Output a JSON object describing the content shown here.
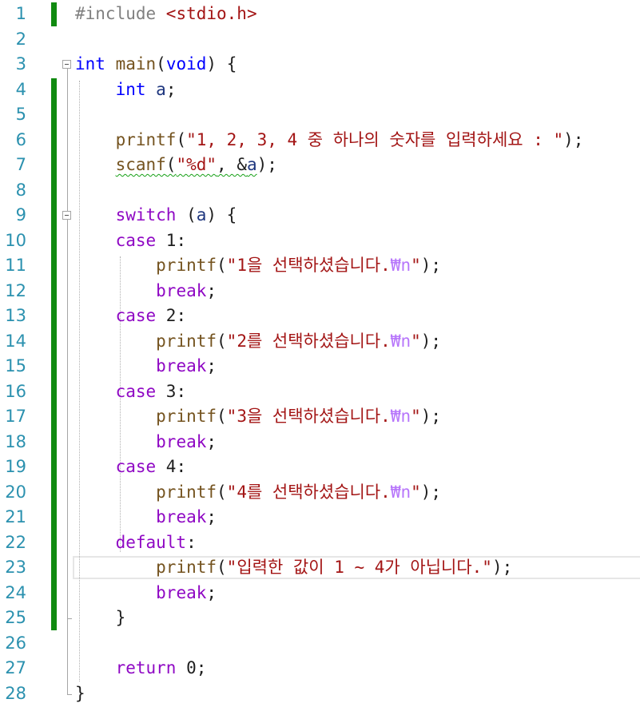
{
  "editor": {
    "line_numbers": [
      "1",
      "2",
      "3",
      "4",
      "5",
      "6",
      "7",
      "8",
      "9",
      "10",
      "11",
      "12",
      "13",
      "14",
      "15",
      "16",
      "17",
      "18",
      "19",
      "20",
      "21",
      "22",
      "23",
      "24",
      "25",
      "26",
      "27",
      "28"
    ],
    "current_line": "23",
    "lines": [
      [
        {
          "t": "#include ",
          "c": "pre"
        },
        {
          "t": "<stdio.h>",
          "c": "inc"
        }
      ],
      [],
      [
        {
          "t": "int",
          "c": "kw"
        },
        {
          "t": " ",
          "c": "plain"
        },
        {
          "t": "main",
          "c": "fn"
        },
        {
          "t": "(",
          "c": "plain"
        },
        {
          "t": "void",
          "c": "kw"
        },
        {
          "t": ") {",
          "c": "plain"
        }
      ],
      [
        {
          "t": "    ",
          "c": "plain"
        },
        {
          "t": "int",
          "c": "kw"
        },
        {
          "t": " ",
          "c": "plain"
        },
        {
          "t": "a",
          "c": "var"
        },
        {
          "t": ";",
          "c": "plain"
        }
      ],
      [],
      [
        {
          "t": "    ",
          "c": "plain"
        },
        {
          "t": "printf",
          "c": "fn"
        },
        {
          "t": "(",
          "c": "plain"
        },
        {
          "t": "\"1, 2, 3, 4 중 하나의 숫자를 입력하세요 : \"",
          "c": "str"
        },
        {
          "t": ");",
          "c": "plain"
        }
      ],
      [
        {
          "t": "    ",
          "c": "plain"
        },
        {
          "t": "scanf",
          "c": "fn",
          "u": true
        },
        {
          "t": "(",
          "c": "plain",
          "u": true
        },
        {
          "t": "\"%d\"",
          "c": "str",
          "u": true
        },
        {
          "t": ", &",
          "c": "plain",
          "u": true
        },
        {
          "t": "a",
          "c": "var",
          "u": true
        },
        {
          "t": ");",
          "c": "plain"
        }
      ],
      [],
      [
        {
          "t": "    ",
          "c": "plain"
        },
        {
          "t": "switch",
          "c": "ctl"
        },
        {
          "t": " (",
          "c": "plain"
        },
        {
          "t": "a",
          "c": "var"
        },
        {
          "t": ") {",
          "c": "plain"
        }
      ],
      [
        {
          "t": "    ",
          "c": "plain"
        },
        {
          "t": "case",
          "c": "ctl"
        },
        {
          "t": " 1:",
          "c": "plain"
        }
      ],
      [
        {
          "t": "        ",
          "c": "plain"
        },
        {
          "t": "printf",
          "c": "fn"
        },
        {
          "t": "(",
          "c": "plain"
        },
        {
          "t": "\"1을 선택하셨습니다.",
          "c": "str"
        },
        {
          "t": "₩n",
          "c": "esc"
        },
        {
          "t": "\"",
          "c": "str"
        },
        {
          "t": ");",
          "c": "plain"
        }
      ],
      [
        {
          "t": "        ",
          "c": "plain"
        },
        {
          "t": "break",
          "c": "ctl"
        },
        {
          "t": ";",
          "c": "plain"
        }
      ],
      [
        {
          "t": "    ",
          "c": "plain"
        },
        {
          "t": "case",
          "c": "ctl"
        },
        {
          "t": " 2:",
          "c": "plain"
        }
      ],
      [
        {
          "t": "        ",
          "c": "plain"
        },
        {
          "t": "printf",
          "c": "fn"
        },
        {
          "t": "(",
          "c": "plain"
        },
        {
          "t": "\"2를 선택하셨습니다.",
          "c": "str"
        },
        {
          "t": "₩n",
          "c": "esc"
        },
        {
          "t": "\"",
          "c": "str"
        },
        {
          "t": ");",
          "c": "plain"
        }
      ],
      [
        {
          "t": "        ",
          "c": "plain"
        },
        {
          "t": "break",
          "c": "ctl"
        },
        {
          "t": ";",
          "c": "plain"
        }
      ],
      [
        {
          "t": "    ",
          "c": "plain"
        },
        {
          "t": "case",
          "c": "ctl"
        },
        {
          "t": " 3:",
          "c": "plain"
        }
      ],
      [
        {
          "t": "        ",
          "c": "plain"
        },
        {
          "t": "printf",
          "c": "fn"
        },
        {
          "t": "(",
          "c": "plain"
        },
        {
          "t": "\"3을 선택하셨습니다.",
          "c": "str"
        },
        {
          "t": "₩n",
          "c": "esc"
        },
        {
          "t": "\"",
          "c": "str"
        },
        {
          "t": ");",
          "c": "plain"
        }
      ],
      [
        {
          "t": "        ",
          "c": "plain"
        },
        {
          "t": "break",
          "c": "ctl"
        },
        {
          "t": ";",
          "c": "plain"
        }
      ],
      [
        {
          "t": "    ",
          "c": "plain"
        },
        {
          "t": "case",
          "c": "ctl"
        },
        {
          "t": " 4:",
          "c": "plain"
        }
      ],
      [
        {
          "t": "        ",
          "c": "plain"
        },
        {
          "t": "printf",
          "c": "fn"
        },
        {
          "t": "(",
          "c": "plain"
        },
        {
          "t": "\"4를 선택하셨습니다.",
          "c": "str"
        },
        {
          "t": "₩n",
          "c": "esc"
        },
        {
          "t": "\"",
          "c": "str"
        },
        {
          "t": ");",
          "c": "plain"
        }
      ],
      [
        {
          "t": "        ",
          "c": "plain"
        },
        {
          "t": "break",
          "c": "ctl"
        },
        {
          "t": ";",
          "c": "plain"
        }
      ],
      [
        {
          "t": "    ",
          "c": "plain"
        },
        {
          "t": "default",
          "c": "ctl"
        },
        {
          "t": ":",
          "c": "plain"
        }
      ],
      [
        {
          "t": "        ",
          "c": "plain"
        },
        {
          "t": "printf",
          "c": "fn"
        },
        {
          "t": "(",
          "c": "plain"
        },
        {
          "t": "\"입력한 값이 1 ~ 4가 아닙니다.\"",
          "c": "str"
        },
        {
          "t": ");",
          "c": "plain"
        }
      ],
      [
        {
          "t": "        ",
          "c": "plain"
        },
        {
          "t": "break",
          "c": "ctl"
        },
        {
          "t": ";",
          "c": "plain"
        }
      ],
      [
        {
          "t": "    }",
          "c": "plain"
        }
      ],
      [],
      [
        {
          "t": "    ",
          "c": "plain"
        },
        {
          "t": "return",
          "c": "ctl"
        },
        {
          "t": " 0;",
          "c": "plain"
        }
      ],
      [
        {
          "t": "}",
          "c": "plain"
        }
      ]
    ]
  },
  "colors": {
    "line_number": "#2b91af",
    "keyword": "#0000ff",
    "control_keyword": "#8f08c4",
    "function": "#74531f",
    "string": "#a31515",
    "escape": "#b776fb",
    "variable": "#1f377f",
    "change_bar": "#108a10",
    "squiggle": "#16a016"
  }
}
